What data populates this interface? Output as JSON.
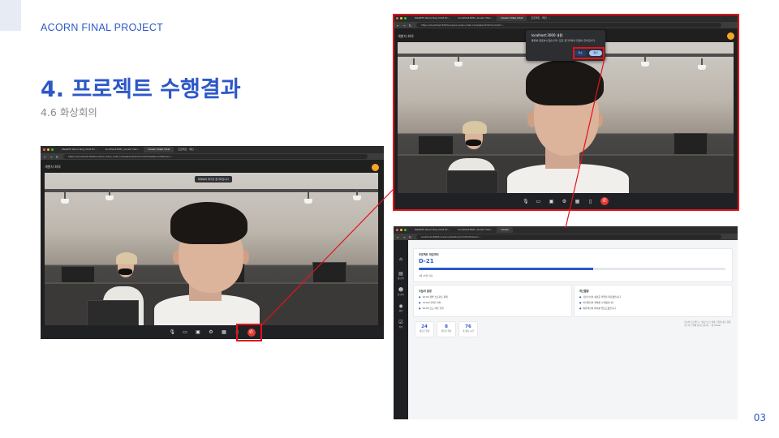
{
  "slide": {
    "header": "ACORN FINAL PROJECT",
    "title": "4. 프로젝트 수행결과",
    "subtitle": "4.6 화상회의",
    "page_number": "03"
  },
  "colors": {
    "accent": "#2d58c8",
    "highlight": "#e0141b",
    "end_call": "#e53935"
  },
  "window_main": {
    "tabs": [
      "WebRTC Recording Chat Ex...",
      "localhost:808 | Linwin Harr...",
      "Ocean Video Chat",
      "프로젝트 - 메인 ..."
    ],
    "url": "https://localhost:3000/oceans-video-chat-complete.html?roomId=test&roomName=...",
    "room_title": "개발자 회의",
    "tooltip": "회의에서 제거할 참가자입니다",
    "controls": [
      "mic-icon",
      "camera-icon",
      "screen-share-icon",
      "settings-icon",
      "grid-icon",
      "chat-icon",
      "end-call-icon"
    ],
    "control_glyphs": {
      "mic": "🎙",
      "camera": "▭",
      "screen": "▣",
      "settings": "⚙",
      "grid": "▦",
      "chat": "▯",
      "end": "✆"
    }
  },
  "window_dialog": {
    "tabs": [
      "WebRTC Recording Chat Ex...",
      "localhost:808 | Linwin Harr...",
      "Ocean Video Chat",
      "프로젝트 - 메인 ..."
    ],
    "url": "https://localhost:3000/oceans-video-chat-complete.html?roomId=...",
    "room_title": "개발자 회의",
    "dialog": {
      "title": "localhost:3000 내용:",
      "message": "통화를 종료하시겠습니까? 모든 참가자와의 연결이 끊어집니다.",
      "cancel": "취소",
      "confirm": "확인"
    }
  },
  "window_dashboard": {
    "tabs": [
      "WebRTC Recording Chat Ex...",
      "localhost:808 | Linwin Harr...",
      "Ocean"
    ],
    "url": "localhost:8080/oceans/dashboard.html?token=...",
    "nav": [
      {
        "icon": "home-icon",
        "glyph": "⌂",
        "label": ""
      },
      {
        "icon": "calendar-icon",
        "glyph": "▤",
        "label": "캘 린더"
      },
      {
        "icon": "team-icon",
        "glyph": "☻",
        "label": "팀 관리"
      },
      {
        "icon": "location-icon",
        "glyph": "◉",
        "label": "위치"
      },
      {
        "icon": "task-icon",
        "glyph": "☑",
        "label": "업무"
      }
    ],
    "project_card": {
      "title": "프로젝트 마감까지",
      "dday": "D-21",
      "progress": 0.57,
      "caption": "4월 25일 마감"
    },
    "today_card": {
      "title": "오늘의 일정",
      "items": [
        "10:00 개발 스프린트 회의",
        "14:00 디자인 리뷰",
        "16:00 코드 리뷰 진행"
      ]
    },
    "recent_card": {
      "title": "최근활동",
      "items": [
        "김민수님이 새로운 작업을 완료했습니다",
        "이지은님이 회의를 시작했습니다",
        "박준혁님이 문서를 업로드했습니다"
      ]
    },
    "stats": [
      {
        "value": "24",
        "label": "새로운 알림"
      },
      {
        "value": "8",
        "label": "완료된 일정"
      },
      {
        "value": "76",
        "label": "총 활동 시간"
      }
    ],
    "note": "오늘의 프로젝트는 \"성공\"으로 향하고 있습니다. 팀원 모두의 노력에 감사드립니다. - 팀 Ocean"
  }
}
